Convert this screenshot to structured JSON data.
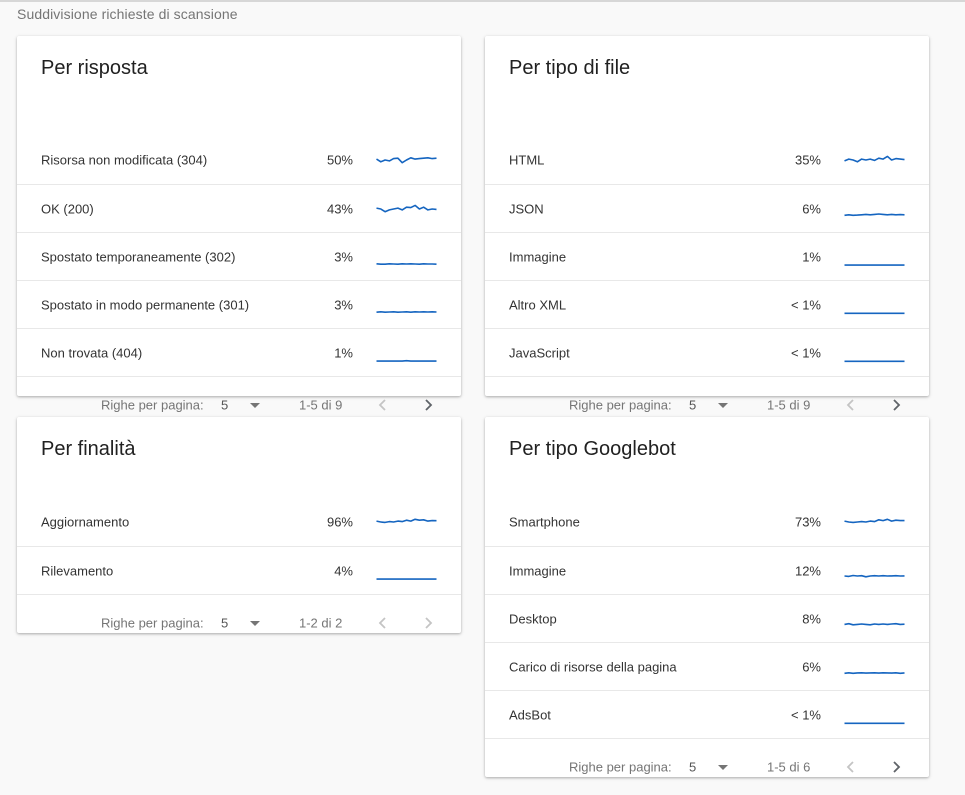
{
  "section_title": "Suddivisione richieste di scansione",
  "colors": {
    "accent": "#1a73e8",
    "spark": "#1565c0",
    "disabled_arrow": "#c4c4c4",
    "active_arrow": "#5f6368"
  },
  "icons": {
    "dropdown": "triangle-down-icon",
    "prev": "chevron-left-icon",
    "next": "chevron-right-icon"
  },
  "cards": [
    {
      "title": "Per risposta",
      "rows": [
        {
          "label": "Risorsa non modificata (304)",
          "pct": "50%",
          "trend": [
            0.55,
            0.4,
            0.5,
            0.45,
            0.58,
            0.6,
            0.35,
            0.5,
            0.62,
            0.55,
            0.58,
            0.6,
            0.62,
            0.58,
            0.6
          ]
        },
        {
          "label": "OK (200)",
          "pct": "43%",
          "trend": [
            0.55,
            0.5,
            0.35,
            0.45,
            0.5,
            0.55,
            0.45,
            0.6,
            0.58,
            0.7,
            0.5,
            0.6,
            0.45,
            0.5,
            0.48
          ]
        },
        {
          "label": "Spostato temporaneamente (302)",
          "pct": "3%",
          "trend": [
            0.12,
            0.1,
            0.1,
            0.12,
            0.11,
            0.1,
            0.12,
            0.11,
            0.12,
            0.11,
            0.1,
            0.12,
            0.11,
            0.11,
            0.1
          ]
        },
        {
          "label": "Spostato in modo permanente (301)",
          "pct": "3%",
          "trend": [
            0.1,
            0.12,
            0.1,
            0.11,
            0.12,
            0.1,
            0.11,
            0.12,
            0.1,
            0.12,
            0.11,
            0.12,
            0.11,
            0.12,
            0.11
          ]
        },
        {
          "label": "Non trovata (404)",
          "pct": "1%",
          "trend": [
            0.05,
            0.05,
            0.05,
            0.05,
            0.05,
            0.05,
            0.05,
            0.07,
            0.05,
            0.05,
            0.05,
            0.05,
            0.05,
            0.05,
            0.05
          ]
        }
      ],
      "footer": {
        "label": "Righe per pagina:",
        "value": "5",
        "range": "1-5 di 9",
        "prev_enabled": false,
        "next_enabled": true
      }
    },
    {
      "title": "Per tipo di file",
      "rows": [
        {
          "label": "HTML",
          "pct": "35%",
          "trend": [
            0.45,
            0.55,
            0.5,
            0.4,
            0.55,
            0.5,
            0.55,
            0.48,
            0.6,
            0.55,
            0.7,
            0.5,
            0.58,
            0.55,
            0.52
          ]
        },
        {
          "label": "JSON",
          "pct": "6%",
          "trend": [
            0.15,
            0.18,
            0.15,
            0.16,
            0.18,
            0.2,
            0.18,
            0.2,
            0.22,
            0.2,
            0.18,
            0.2,
            0.18,
            0.19,
            0.18
          ]
        },
        {
          "label": "Immagine",
          "pct": "1%",
          "trend": [
            0.05,
            0.05,
            0.05,
            0.05,
            0.05,
            0.05,
            0.05,
            0.05,
            0.05,
            0.05,
            0.05,
            0.05,
            0.05,
            0.05,
            0.05
          ]
        },
        {
          "label": "Altro XML",
          "pct": "< 1%",
          "trend": [
            0.04,
            0.04,
            0.04,
            0.04,
            0.04,
            0.04,
            0.04,
            0.04,
            0.04,
            0.04,
            0.04,
            0.04,
            0.04,
            0.04,
            0.04
          ]
        },
        {
          "label": "JavaScript",
          "pct": "< 1%",
          "trend": [
            0.04,
            0.04,
            0.04,
            0.04,
            0.04,
            0.04,
            0.04,
            0.04,
            0.04,
            0.04,
            0.04,
            0.04,
            0.04,
            0.04,
            0.04
          ]
        }
      ],
      "footer": {
        "label": "Righe per pagina:",
        "value": "5",
        "range": "1-5 di 9",
        "prev_enabled": false,
        "next_enabled": true
      }
    },
    {
      "title": "Per finalità",
      "rows": [
        {
          "label": "Aggiornamento",
          "pct": "96%",
          "trend": [
            0.55,
            0.5,
            0.48,
            0.52,
            0.5,
            0.55,
            0.52,
            0.6,
            0.55,
            0.65,
            0.6,
            0.62,
            0.55,
            0.58,
            0.57
          ]
        },
        {
          "label": "Rilevamento",
          "pct": "4%",
          "trend": [
            0.05,
            0.05,
            0.05,
            0.05,
            0.05,
            0.05,
            0.05,
            0.05,
            0.05,
            0.05,
            0.05,
            0.05,
            0.05,
            0.05,
            0.05
          ]
        }
      ],
      "footer": {
        "label": "Righe per pagina:",
        "value": "5",
        "range": "1-2 di 2",
        "prev_enabled": false,
        "next_enabled": false
      }
    },
    {
      "title": "Per tipo Googlebot",
      "rows": [
        {
          "label": "Smartphone",
          "pct": "73%",
          "trend": [
            0.55,
            0.5,
            0.48,
            0.5,
            0.52,
            0.5,
            0.55,
            0.52,
            0.62,
            0.58,
            0.65,
            0.55,
            0.6,
            0.58,
            0.58
          ]
        },
        {
          "label": "Immagine",
          "pct": "12%",
          "trend": [
            0.22,
            0.2,
            0.25,
            0.22,
            0.24,
            0.18,
            0.22,
            0.24,
            0.22,
            0.24,
            0.22,
            0.23,
            0.24,
            0.22,
            0.23
          ]
        },
        {
          "label": "Desktop",
          "pct": "8%",
          "trend": [
            0.2,
            0.24,
            0.18,
            0.2,
            0.22,
            0.2,
            0.18,
            0.22,
            0.2,
            0.22,
            0.2,
            0.22,
            0.24,
            0.2,
            0.21
          ]
        },
        {
          "label": "Carico di risorse della pagina",
          "pct": "6%",
          "trend": [
            0.15,
            0.18,
            0.15,
            0.17,
            0.18,
            0.16,
            0.17,
            0.18,
            0.16,
            0.18,
            0.17,
            0.16,
            0.18,
            0.15,
            0.17
          ]
        },
        {
          "label": "AdsBot",
          "pct": "< 1%",
          "trend": [
            0.04,
            0.04,
            0.04,
            0.04,
            0.04,
            0.04,
            0.04,
            0.04,
            0.04,
            0.04,
            0.04,
            0.04,
            0.04,
            0.04,
            0.04
          ]
        }
      ],
      "footer": {
        "label": "Righe per pagina:",
        "value": "5",
        "range": "1-5 di 6",
        "prev_enabled": false,
        "next_enabled": true
      }
    }
  ]
}
